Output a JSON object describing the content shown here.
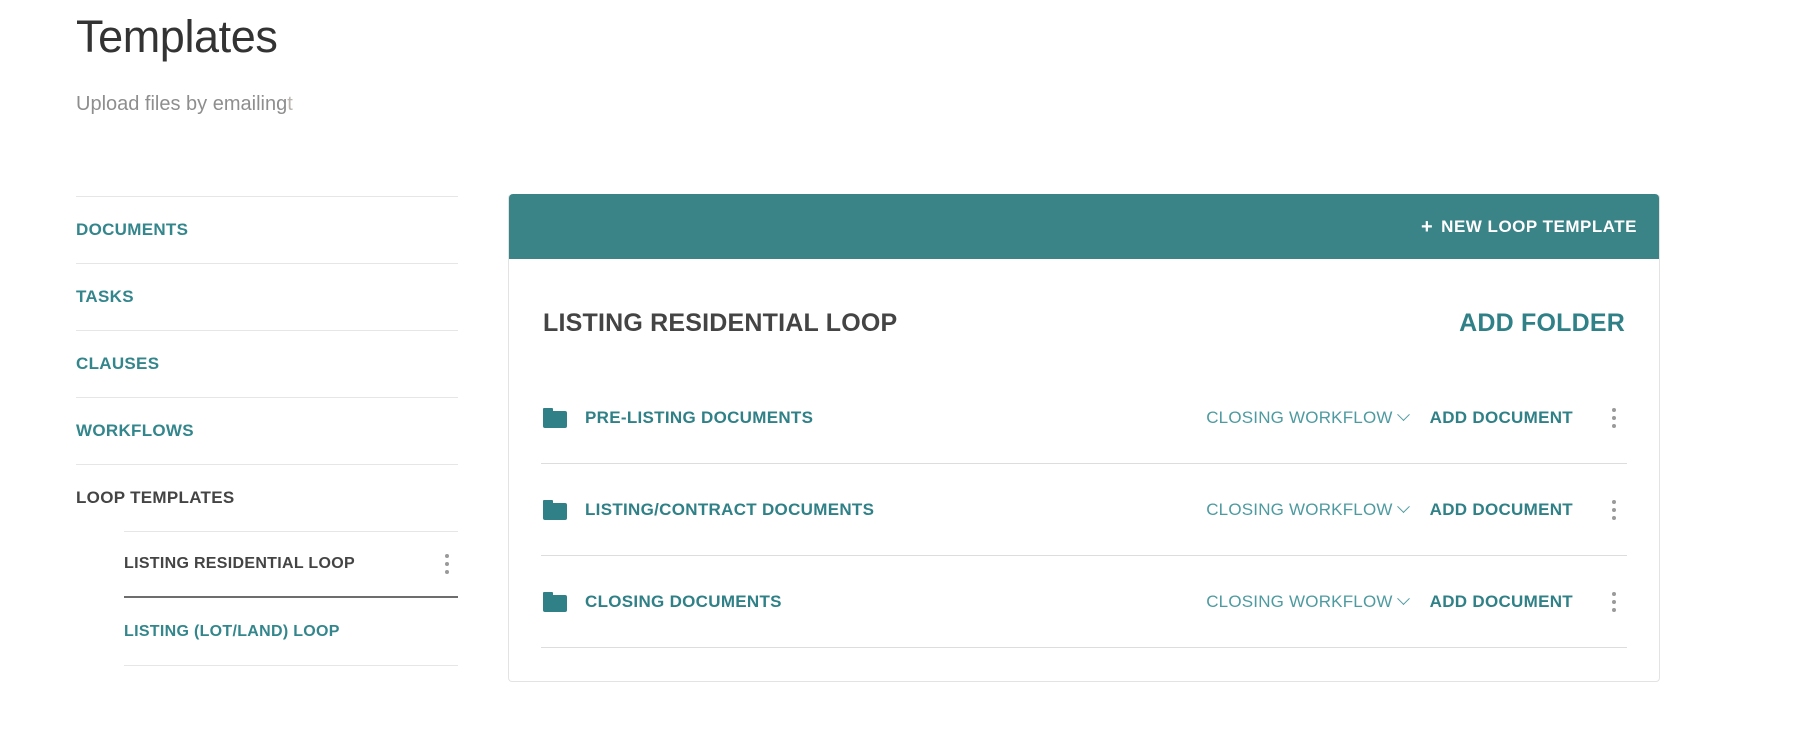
{
  "page": {
    "title": "Templates",
    "subtitle": "Upload files by emailing",
    "subtitle_truncated_char": "t"
  },
  "colors": {
    "teal_header": "#3a8488",
    "teal_link": "#2f8187",
    "teal_muted": "#4d9ba0",
    "dark_text": "#444444",
    "divider": "#e6e6e6"
  },
  "sidebar": {
    "items": [
      {
        "label": "DOCUMENTS",
        "active": false
      },
      {
        "label": "TASKS",
        "active": false
      },
      {
        "label": "CLAUSES",
        "active": false
      },
      {
        "label": "WORKFLOWS",
        "active": false
      },
      {
        "label": "LOOP TEMPLATES",
        "active": true
      }
    ],
    "sub_items": [
      {
        "label": "LISTING RESIDENTIAL LOOP",
        "active": true,
        "has_menu": true
      },
      {
        "label": "LISTING (LOT/LAND) LOOP",
        "active": false,
        "has_menu": false
      }
    ]
  },
  "card": {
    "new_template_button": {
      "plus": "+",
      "label": "NEW LOOP TEMPLATE"
    },
    "title": "LISTING RESIDENTIAL LOOP",
    "add_folder_label": "ADD FOLDER",
    "folders": [
      {
        "name": "PRE-LISTING DOCUMENTS",
        "workflow": "CLOSING WORKFLOW",
        "add_document_label": "ADD DOCUMENT"
      },
      {
        "name": "LISTING/CONTRACT DOCUMENTS",
        "workflow": "CLOSING WORKFLOW",
        "add_document_label": "ADD DOCUMENT"
      },
      {
        "name": "CLOSING DOCUMENTS",
        "workflow": "CLOSING WORKFLOW",
        "add_document_label": "ADD DOCUMENT"
      }
    ]
  }
}
